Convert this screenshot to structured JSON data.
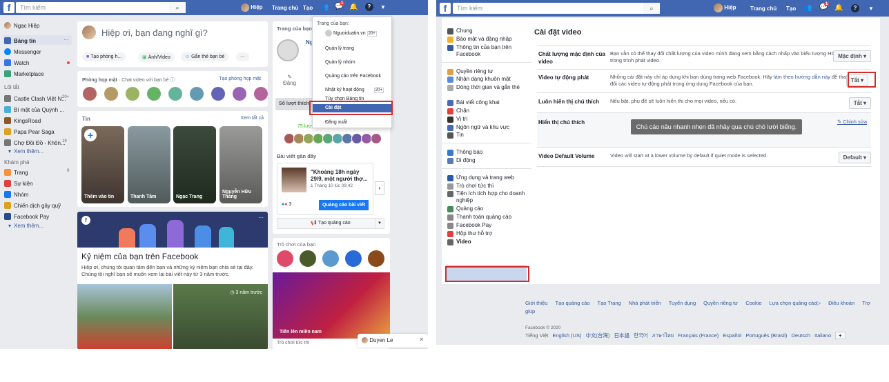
{
  "left": {
    "search_placeholder": "Tìm kiếm",
    "nav": {
      "user": "Hiệp",
      "home": "Trang chủ",
      "create": "Tạo",
      "messenger_badge": "1"
    },
    "sidebar": {
      "user": "Ngạc Hiệp",
      "main": [
        {
          "label": "Bảng tin",
          "icon": "news-feed-icon"
        },
        {
          "label": "Messenger",
          "icon": "messenger-icon"
        },
        {
          "label": "Watch",
          "icon": "watch-icon"
        },
        {
          "label": "Marketplace",
          "icon": "marketplace-icon"
        }
      ],
      "shortcuts_title": "Lối tắt",
      "shortcuts": [
        {
          "label": "Castle Clash Việt N...",
          "count": "20+"
        },
        {
          "label": "Bí mật của Quỳnh ...",
          "count": ""
        },
        {
          "label": "KingsRoad",
          "count": ""
        },
        {
          "label": "Papa Pear Saga",
          "count": ""
        },
        {
          "label": "Chợ Đồi Đồ - Khôn...",
          "count": "19"
        }
      ],
      "see_more": "Xem thêm...",
      "explore_title": "Khám phá",
      "explore": [
        {
          "label": "Trang",
          "count": "9"
        },
        {
          "label": "Sự kiện",
          "count": ""
        },
        {
          "label": "Nhóm",
          "count": ""
        },
        {
          "label": "Chiến dịch gây quỹ",
          "count": ""
        },
        {
          "label": "Facebook Pay",
          "count": ""
        }
      ],
      "see_more2": "Xem thêm..."
    },
    "composer": {
      "placeholder": "Hiệp ơi, bạn đang nghĩ gì?",
      "room": "Tạo phòng h...",
      "photo": "Ảnh/Video",
      "tag": "Gắn thẻ bạn bè",
      "more": "···"
    },
    "rooms": {
      "title": "Phòng họp mặt",
      "subtitle": " · Chat video với bạn bè",
      "create": "Tạo phòng họp mặt"
    },
    "stories": {
      "title": "Tin",
      "see_all": "Xem tất cả",
      "items": [
        "Thêm vào tin",
        "Thanh Tâm",
        "Ngạc Trang",
        "Nguyễn Hữu Thắng"
      ]
    },
    "memory": {
      "title": "Kỷ niệm của bạn trên Facebook",
      "text": "Hiệp ơi, chúng tôi quan tâm đến bạn và những kỷ niệm bạn chia sẻ tại đây. Chúng tôi nghĩ bạn sẽ muốn xem lại bài viết này từ 3 năm trước.",
      "time_badge": "3 năm trước"
    },
    "page_panel": {
      "title": "Trang của bạn",
      "name": "Ng",
      "post": "Đăng",
      "likes_label": "Số lượt thích",
      "likes_count": "75 lượt",
      "recent": "Bài viết gần đây",
      "post_title": "\"Khoảng 18h ngày 29/9, một người thợ...",
      "post_date": "1 Tháng 10 lúc 09:42",
      "reactions": "3",
      "boost": "Quảng cáo bài viết",
      "create_ad": "Tạo quảng cáo"
    },
    "games": {
      "title": "Trò chơi của bạn",
      "banner": "Tiến lên miền nam",
      "instant": "Trò chơi tức thì"
    },
    "chat": {
      "name": "Duyen Le"
    },
    "dropdown": {
      "your_pages": "Trang của bạn:",
      "page": "Nguoiduatin.vn",
      "page_count": "20+",
      "items": [
        "Quản lý trang",
        "Quản lý nhóm",
        "Quảng cáo trên Facebook",
        "Nhật ký hoạt động",
        "Tùy chọn Bảng tin",
        "Cài đặt",
        "Đăng xuất"
      ],
      "activity_count": "20+"
    }
  },
  "right": {
    "search_placeholder": "Tìm kiếm",
    "nav": {
      "user": "Hiệp",
      "home": "Trang chủ",
      "create": "Tạo",
      "badge": "1"
    },
    "sidebar": [
      [
        {
          "label": "Chung",
          "icon": "gear-icon"
        },
        {
          "label": "Bảo mật và đăng nhập",
          "icon": "shield-icon"
        },
        {
          "label": "Thông tin của bạn trên Facebook",
          "icon": "facebook-icon"
        }
      ],
      [
        {
          "label": "Quyền riêng tư",
          "icon": "lock-icon"
        },
        {
          "label": "Nhận dạng khuôn mặt",
          "icon": "face-icon"
        },
        {
          "label": "Dòng thời gian và gắn thẻ",
          "icon": "timeline-icon"
        },
        {
          "label": "Bài viết công khai",
          "icon": "rss-icon"
        },
        {
          "label": "Chặn",
          "icon": "block-icon"
        },
        {
          "label": "Vị trí",
          "icon": "location-icon"
        },
        {
          "label": "Ngôn ngữ và khu vực",
          "icon": "language-icon"
        },
        {
          "label": "Tin",
          "icon": "book-icon"
        }
      ],
      [
        {
          "label": "Thông báo",
          "icon": "globe-icon"
        },
        {
          "label": "Di động",
          "icon": "mobile-icon"
        }
      ],
      [
        {
          "label": "Ứng dụng và trang web",
          "icon": "apps-icon"
        },
        {
          "label": "Trò chơi tức thì",
          "icon": "gamepad-icon"
        },
        {
          "label": "Tiện ích tích hợp cho doanh nghiệp",
          "icon": "integration-icon"
        },
        {
          "label": "Quảng cáo",
          "icon": "ads-icon"
        },
        {
          "label": "Thanh toán quảng cáo",
          "icon": "card-icon"
        },
        {
          "label": "Facebook Pay",
          "icon": "card-icon"
        },
        {
          "label": "Hộp thư hỗ trợ",
          "icon": "lifebuoy-icon"
        },
        {
          "label": "Video",
          "icon": "film-icon"
        }
      ]
    ],
    "title": "Cài đặt video",
    "rows": [
      {
        "label": "Chất lượng mặc định của video",
        "desc": "Bạn vẫn có thể thay đổi chất lượng của video mình đang xem bằng cách nhấp vào biểu tượng HD trong trình phát video.",
        "value": "Mặc định"
      },
      {
        "label": "Video tự động phát",
        "desc_a": "Những cài đặt này chỉ áp dụng khi bạn dùng trang web Facebook. Hãy ",
        "desc_link": "làm theo hướng dẫn này",
        "desc_b": " để thay đổi các video tự động phát trong ứng dụng Facebook của bạn.",
        "value": "Tắt"
      },
      {
        "label": "Luôn hiển thị chú thích",
        "desc": "Nếu bật, phụ đề sẽ luôn hiển thị cho mọi video, nếu có.",
        "value": "Tắt"
      },
      {
        "label": "Hiển thị chú thích",
        "preview": "Chú cáo nâu nhanh nhẹn đã nhảy qua chú chó lười biếng.",
        "edit": "Chỉnh sửa"
      },
      {
        "label": "Video Default Volume",
        "desc": "Video will start at a lower volume by default if quiet mode is selected.",
        "value": "Default"
      }
    ],
    "footer": {
      "links": [
        "Giới thiệu",
        "Tạo quảng cáo",
        "Tạo Trang",
        "Nhà phát triển",
        "Tuyển dụng",
        "Quyền riêng tư",
        "Cookie",
        "Lựa chọn quảng cáo",
        "Điều khoản",
        "Trợ giúp"
      ],
      "copyright": "Facebook © 2020",
      "current_lang": "Tiếng Việt",
      "languages": [
        "English (US)",
        "中文(台灣)",
        "日本語",
        "한국어",
        "ภาษาไทย",
        "Français (France)",
        "Español",
        "Português (Brasil)",
        "Deutsch",
        "Italiano"
      ],
      "more": "+"
    }
  },
  "colors": {
    "brand": "#4267b2",
    "highlight": "#d32a2a",
    "selected": "#c9d7ee"
  }
}
